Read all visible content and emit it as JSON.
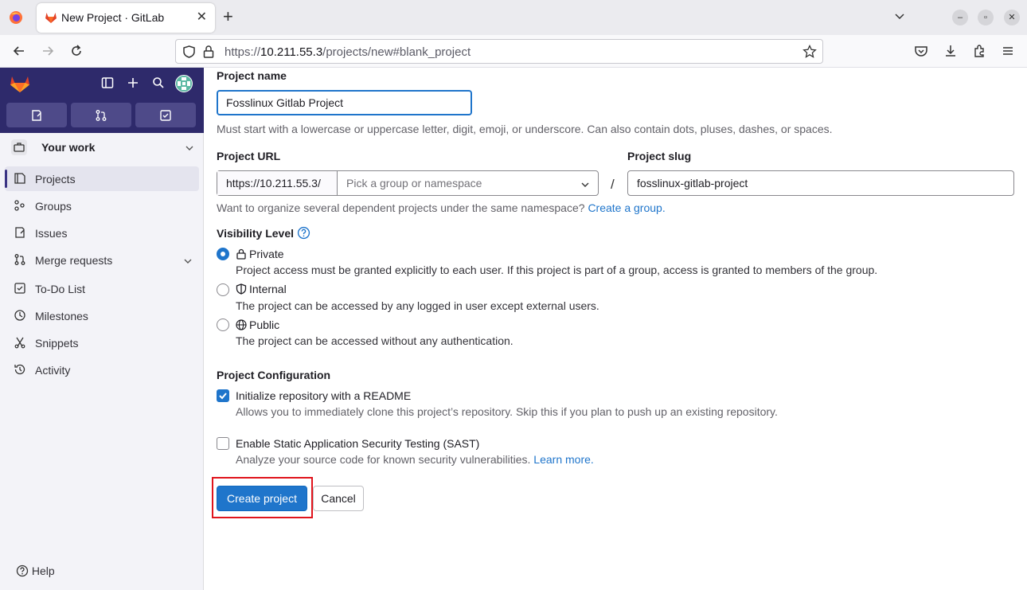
{
  "browser": {
    "tab_title": "New Project · GitLab",
    "url_prefix": "https://",
    "url_host": "10.211.55.3",
    "url_path": "/projects/new#blank_project"
  },
  "sidebar": {
    "context_label": "Your work",
    "items": [
      {
        "label": "Projects",
        "icon": "project-icon"
      },
      {
        "label": "Groups",
        "icon": "group-icon"
      },
      {
        "label": "Issues",
        "icon": "issues-icon"
      },
      {
        "label": "Merge requests",
        "icon": "merge-request-icon"
      },
      {
        "label": "To-Do List",
        "icon": "todo-icon"
      },
      {
        "label": "Milestones",
        "icon": "milestone-icon"
      },
      {
        "label": "Snippets",
        "icon": "snippet-icon"
      },
      {
        "label": "Activity",
        "icon": "history-icon"
      }
    ],
    "help_label": "Help"
  },
  "form": {
    "project_name_label": "Project name",
    "project_name_value": "Fosslinux Gitlab Project",
    "project_name_help": "Must start with a lowercase or uppercase letter, digit, emoji, or underscore. Can also contain dots, pluses, dashes, or spaces.",
    "project_url_label": "Project URL",
    "project_url_prefix": "https://10.211.55.3/",
    "namespace_placeholder": "Pick a group or namespace",
    "separator": "/",
    "project_slug_label": "Project slug",
    "project_slug_value": "fosslinux-gitlab-project",
    "namespace_help": "Want to organize several dependent projects under the same namespace?",
    "create_group_link": "Create a group.",
    "visibility_label": "Visibility Level",
    "visibility_options": [
      {
        "label": "Private",
        "description": "Project access must be granted explicitly to each user. If this project is part of a group, access is granted to members of the group.",
        "checked": true
      },
      {
        "label": "Internal",
        "description": "The project can be accessed by any logged in user except external users.",
        "checked": false
      },
      {
        "label": "Public",
        "description": "The project can be accessed without any authentication.",
        "checked": false
      }
    ],
    "config_label": "Project Configuration",
    "readme_label": "Initialize repository with a README",
    "readme_help": "Allows you to immediately clone this project’s repository. Skip this if you plan to push up an existing repository.",
    "readme_checked": true,
    "sast_label": "Enable Static Application Security Testing (SAST)",
    "sast_help": "Analyze your source code for known security vulnerabilities.",
    "sast_link": "Learn more.",
    "sast_checked": false,
    "create_button": "Create project",
    "cancel_button": "Cancel"
  },
  "colors": {
    "sidebar_top": "#2e2a6b",
    "primary": "#1f75cb",
    "highlight": "#e0141c"
  }
}
